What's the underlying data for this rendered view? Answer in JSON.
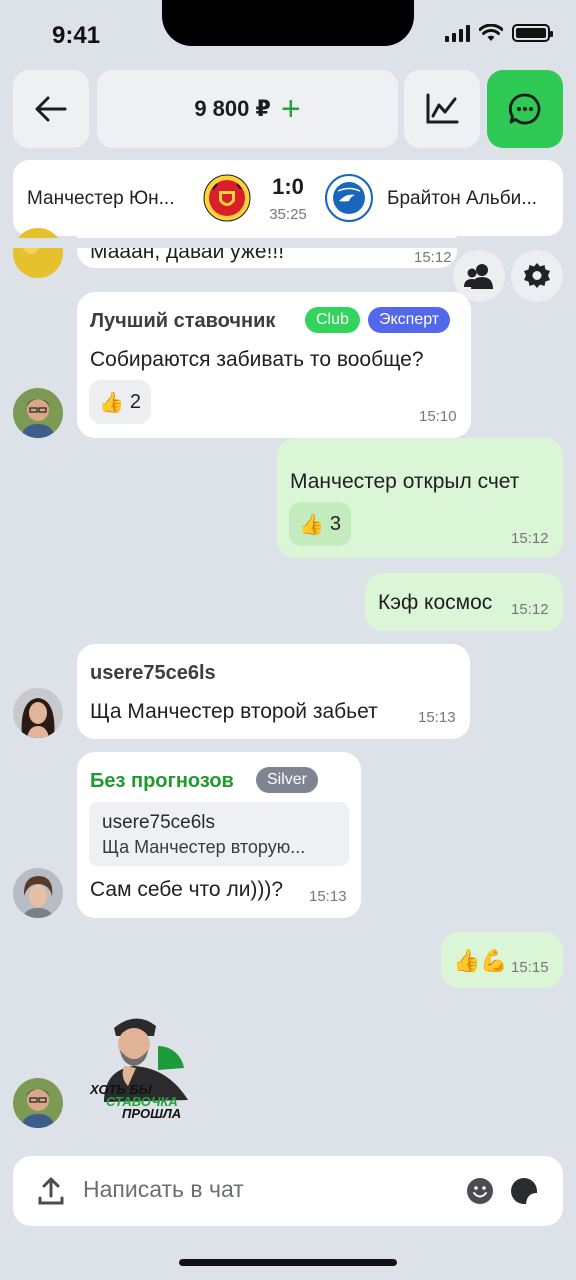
{
  "status_bar": {
    "time": "9:41",
    "battery_level": 1.0
  },
  "header": {
    "balance": "9 800 ₽",
    "balance_plus": "+",
    "icons": [
      "back-arrow-icon",
      "chart-icon",
      "chat-icon"
    ],
    "accent_color": "#2fca55"
  },
  "match": {
    "home_team": "Манчестер Юн...",
    "away_team": "Брайтон Альби...",
    "score": "1:0",
    "time": "35:25"
  },
  "messages": [
    {
      "text": "Мааан, давай уже!!!",
      "time": "15:12"
    },
    {
      "sender": "Лучший ставочник",
      "badges": [
        "Club",
        "Эксперт"
      ],
      "text": "Собираются забивать то вообще?",
      "reaction": {
        "emoji": "👍",
        "count": "2"
      },
      "time": "15:10"
    },
    {
      "text": "Манчестер открыл счет",
      "reaction": {
        "emoji": "👍",
        "count": "3"
      },
      "time": "15:12"
    },
    {
      "text": "Кэф космос",
      "time": "15:12"
    },
    {
      "sender": "usere75ce6ls",
      "text": "Ща Манчестер второй забьет",
      "time": "15:13"
    },
    {
      "sender": "Без прогнозов",
      "badge": "Silver",
      "quote_author": "usere75ce6ls",
      "quote_text": "Ща Манчестер вторую...",
      "text": "Сам себе что ли)))?",
      "time": "15:13"
    },
    {
      "text": "👍💪",
      "time": "15:15"
    }
  ],
  "sticker": {
    "line1": "ХОТЬ БЫ",
    "line2": "СТАВОЧКА",
    "line3": "ПРОШЛА"
  },
  "composer": {
    "placeholder": "Написать в чат"
  }
}
